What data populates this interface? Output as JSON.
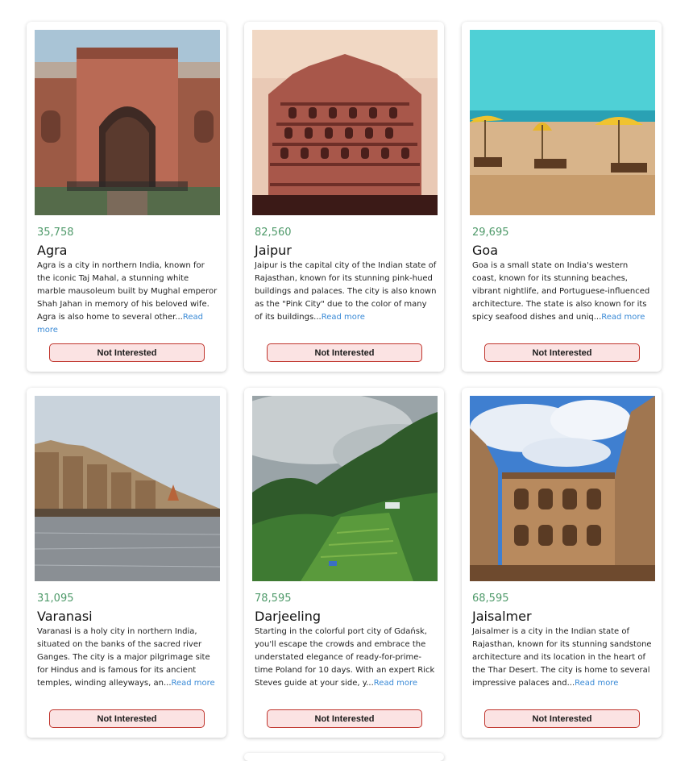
{
  "cards": [
    {
      "count": "35,758",
      "title": "Agra",
      "description": "Agra is a city in northern India, known for the iconic Taj Mahal, a stunning white marble mausoleum built by Mughal emperor Shah Jahan in memory of his beloved wife. Agra is also home to several other...",
      "read_more": "Read more",
      "button": "Not Interested"
    },
    {
      "count": "82,560",
      "title": "Jaipur",
      "description": "Jaipur is the capital city of the Indian state of Rajasthan, known for its stunning pink-hued buildings and palaces. The city is also known as the \"Pink City\" due to the color of many of its buildings...",
      "read_more": "Read more",
      "button": "Not Interested"
    },
    {
      "count": "29,695",
      "title": "Goa",
      "description": "Goa is a small state on India's western coast, known for its stunning beaches, vibrant nightlife, and Portuguese-influenced architecture. The state is also known for its spicy seafood dishes and uniq...",
      "read_more": "Read more",
      "button": "Not Interested"
    },
    {
      "count": "31,095",
      "title": "Varanasi",
      "description": "Varanasi is a holy city in northern India, situated on the banks of the sacred river Ganges. The city is a major pilgrimage site for Hindus and is famous for its ancient temples, winding alleyways, an...",
      "read_more": "Read more",
      "button": "Not Interested"
    },
    {
      "count": "78,595",
      "title": "Darjeeling",
      "description": "Starting in the colorful port city of Gdańsk, you'll escape the crowds and embrace the understated elegance of ready-for-prime-time Poland for 10 days. With an expert Rick Steves guide at your side, y...",
      "read_more": "Read more",
      "button": "Not Interested"
    },
    {
      "count": "68,595",
      "title": "Jaisalmer",
      "description": "Jaisalmer is a city in the Indian state of Rajasthan, known for its stunning sandstone architecture and its location in the heart of the Thar Desert. The city is home to several impressive palaces and...",
      "read_more": "Read more",
      "button": "Not Interested"
    }
  ]
}
